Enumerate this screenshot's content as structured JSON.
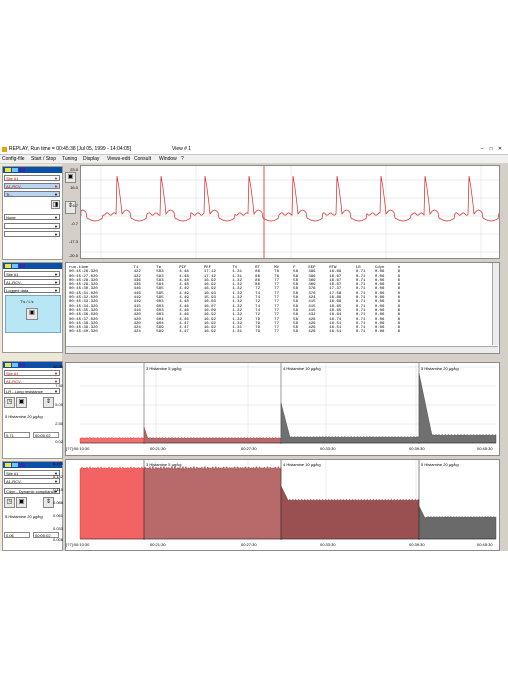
{
  "window": {
    "title": "REPLAY,  Run time = 00:45:38  [Jul 05, 1999 - 14:04:05]",
    "view": "View # 1"
  },
  "menu": [
    "Config-file",
    "Start / Stop",
    "Tuning",
    "Display",
    "Views-edit",
    "Consult",
    "Window",
    "?"
  ],
  "left": {
    "p1": {
      "site": "Site #1",
      "channel": "A1-RCV-",
      "select3": "Tr...",
      "select4": "None"
    },
    "p2": {
      "site": "Site #1",
      "channel": "A1-RCV-",
      "mode": "Logged data",
      "units": "T's / L's",
      "toggle": "T's / L's"
    },
    "p3": {
      "site": "Site #1",
      "channel": "A1-RCV-",
      "param": "LR - Lung resistance",
      "event": "5 Histamine  20 µg/kg",
      "val1": "0.71",
      "val2": "00:00:02"
    },
    "p4": {
      "site": "Site #1",
      "channel": "A1-RCV-",
      "param": "Cdyn - Dynamic compliance",
      "event": "5 Histamine  20 µg/kg",
      "val1": "0.06",
      "val2": "00:00:02"
    }
  },
  "waveform": {
    "yticks": [
      "23.0",
      "16.0",
      "6.7",
      "-0.7",
      "-17.3",
      "-20.0"
    ],
    "color": "#e02020"
  },
  "table": {
    "headers": [
      "run-time",
      "Ti",
      "Te",
      "PIF",
      "PEF",
      "TV",
      "RT",
      "MV",
      "F",
      "EEP",
      "RTW",
      "LR",
      "Cdyn",
      "n"
    ],
    "rows": [
      [
        "00:45:26.320",
        "422",
        "593",
        "4.48",
        "17.12",
        "1.31",
        "86",
        "78",
        "58",
        "396",
        "16.69",
        "0.71",
        "0.06",
        "8"
      ],
      [
        "00:45:27.020",
        "422",
        "593",
        "4.48",
        "17.12",
        "1.31",
        "86",
        "76",
        "58",
        "396",
        "16.67",
        "0.71",
        "0.06",
        "8"
      ],
      [
        "00:45:28.320",
        "436",
        "593",
        "4.48",
        "16.92",
        "1.32",
        "86",
        "77",
        "58",
        "369",
        "16.67",
        "0.71",
        "0.06",
        "8"
      ],
      [
        "00:45:29.320",
        "436",
        "594",
        "4.48",
        "16.92",
        "1.32",
        "86",
        "77",
        "58",
        "369",
        "16.67",
        "0.71",
        "0.06",
        "8"
      ],
      [
        "00:45:30.320",
        "446",
        "595",
        "4.49",
        "16.92",
        "1.32",
        "72",
        "77",
        "58",
        "376",
        "17.37",
        "0.71",
        "0.06",
        "8"
      ],
      [
        "00:45:31.020",
        "446",
        "595",
        "4.49",
        "16.93",
        "1.32",
        "74",
        "77",
        "58",
        "376",
        "17.58",
        "0.71",
        "0.06",
        "8"
      ],
      [
        "00:45:32.020",
        "419",
        "595",
        "4.49",
        "15.93",
        "1.32",
        "74",
        "77",
        "58",
        "424",
        "16.89",
        "0.71",
        "0.06",
        "8"
      ],
      [
        "00:45:33.320",
        "419",
        "603",
        "4.48",
        "16.03",
        "1.32",
        "72",
        "77",
        "58",
        "415",
        "16.69",
        "0.71",
        "0.06",
        "8"
      ],
      [
        "00:45:34.320",
        "415",
        "603",
        "4.46",
        "16.07",
        "1.32",
        "74",
        "77",
        "58",
        "415",
        "16.65",
        "0.71",
        "0.06",
        "8"
      ],
      [
        "00:45:35.320",
        "416",
        "603",
        "4.46",
        "16.09",
        "1.32",
        "74",
        "77",
        "58",
        "415",
        "16.65",
        "0.71",
        "0.06",
        "8"
      ],
      [
        "00:45:36.020",
        "420",
        "603",
        "4.46",
        "16.92",
        "1.32",
        "72",
        "77",
        "58",
        "432",
        "16.64",
        "0.71",
        "0.06",
        "8"
      ],
      [
        "00:45:37.020",
        "420",
        "604",
        "4.46",
        "16.92",
        "1.32",
        "79",
        "77",
        "58",
        "426",
        "16.74",
        "0.71",
        "0.06",
        "8"
      ],
      [
        "00:45:38.320",
        "420",
        "604",
        "4.47",
        "16.92",
        "1.32",
        "79",
        "77",
        "58",
        "426",
        "16.51",
        "0.71",
        "0.06",
        "8"
      ],
      [
        "00:45:39.320",
        "424",
        "599",
        "4.47",
        "16.92",
        "1.31",
        "79",
        "77",
        "58",
        "426",
        "16.51",
        "0.71",
        "0.06",
        "8"
      ],
      [
        "00:45:40.320",
        "424",
        "599",
        "4.47",
        "16.92",
        "1.31",
        "79",
        "77",
        "58",
        "426",
        "16.51",
        "0.71",
        "0.06",
        "8"
      ]
    ]
  },
  "trend1": {
    "yticks": [
      "10.00",
      "7.50",
      "5.00",
      "2.50",
      "0.02"
    ],
    "xticks": [
      "[?7]:00:10:30",
      "00:21:30",
      "00:27:30",
      "00:33:30",
      "00:39:30",
      "00:45:30"
    ],
    "annotations": [
      "3 Histamine  5 µg/kg",
      "4 Histamine  10 µg/kg",
      "5 Histamine  20 µg/kg"
    ]
  },
  "trend2": {
    "yticks": [
      "0.170",
      "0.142",
      "0.115",
      "0.088",
      "0.061",
      "0.033",
      "0.006"
    ],
    "xticks": [
      "[?7]:00:10:30",
      "00:21:30",
      "00:27:30",
      "00:33:30",
      "00:39:30",
      "00:45:30"
    ],
    "annotations": [
      "3 Histamine  5 µg/kg",
      "4 Histamine  10 µg/kg",
      "5 Histamine  20 µg/kg"
    ]
  }
}
